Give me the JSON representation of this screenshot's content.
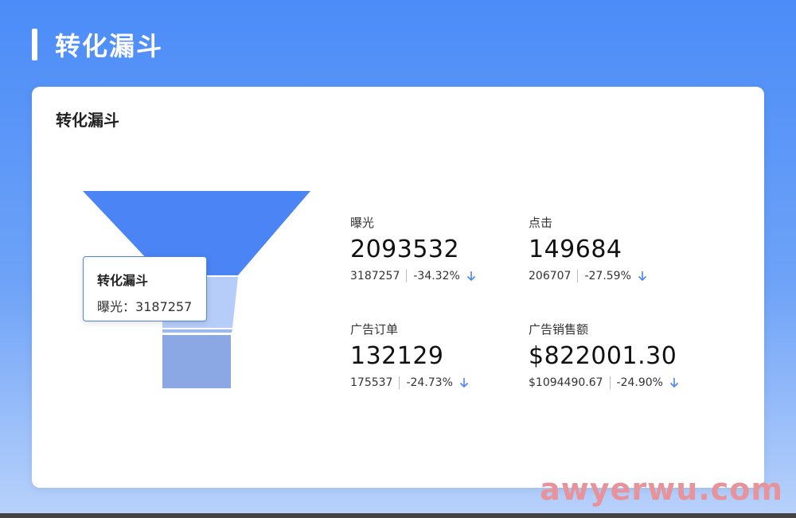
{
  "page": {
    "title": "转化漏斗"
  },
  "card": {
    "title": "转化漏斗"
  },
  "tooltip": {
    "title": "转化漏斗",
    "label": "曝光",
    "value": "3187257"
  },
  "funnel": {
    "stages": [
      "曝光",
      "点击",
      "广告订单",
      "广告销售额"
    ],
    "colors": [
      "#4a84f5",
      "#b5cdf8",
      "#9db7ef",
      "#8ba8e4"
    ]
  },
  "metrics": [
    {
      "label": "曝光",
      "value": "2093532",
      "prev": "3187257",
      "change": "-34.32%",
      "trend": "down"
    },
    {
      "label": "点击",
      "value": "149684",
      "prev": "206707",
      "change": "-27.59%",
      "trend": "down"
    },
    {
      "label": "广告订单",
      "value": "132129",
      "prev": "175537",
      "change": "-24.73%",
      "trend": "down"
    },
    {
      "label": "广告销售额",
      "value": "$822001.30",
      "prev": "$1094490.67",
      "change": "-24.90%",
      "trend": "down"
    }
  ],
  "accent": "#4a84f5",
  "watermark": "awyerwu.com"
}
